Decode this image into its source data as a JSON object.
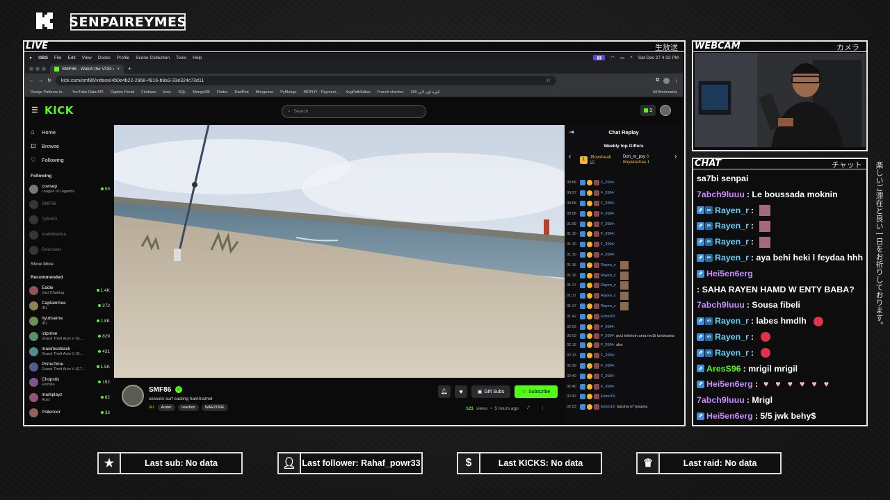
{
  "header": {
    "channel_name": "SENPAIREYMES"
  },
  "panels": {
    "live_title": "LIVE",
    "live_jp": "生放送",
    "webcam_title": "WEBCAM",
    "webcam_jp": "カメラ",
    "chat_title": "CHAT",
    "chat_jp": "チャット",
    "vertical_jp": "楽しいご滞在と良い一日をお祈りしております。"
  },
  "os_menubar": {
    "items": [
      "OBS",
      "File",
      "Edit",
      "View",
      "Docks",
      "Profile",
      "Scene Collection",
      "Tools",
      "Help"
    ],
    "clock": "Sat Dec 27  4:32 PM"
  },
  "browser": {
    "tab_title": "SMF86 - Watch the VOD on K",
    "url": "kick.com/smf86/videos/4b0e4b22-2968-4916-b9a3-33e324c73d11",
    "bookmarks": [
      "Design Patterns In...",
      "YouTube Data API",
      "Captive Portal",
      "Firebase",
      "Ionic",
      "SQL",
      "MongoDB",
      "Flutter",
      "DartPad",
      "Mongoose",
      "PyMongo",
      "MOPHY - Paymeni...",
      "SvgPathEditor",
      "French checker",
      "كورة اون لاين 360"
    ],
    "all_bookmarks": "All Bookmarks"
  },
  "kick": {
    "logo": "KICK",
    "search_placeholder": "Search",
    "badge_count": "3",
    "nav": [
      {
        "label": "Home",
        "icon": "home-icon"
      },
      {
        "label": "Browse",
        "icon": "browse-icon"
      },
      {
        "label": "Following",
        "icon": "heart-icon"
      }
    ],
    "following_label": "Following",
    "following": [
      {
        "name": "cowsep",
        "sub": "League of Legends",
        "count": "59",
        "live": true
      },
      {
        "name": "SMF86",
        "sub": "",
        "count": "",
        "live": false
      },
      {
        "name": "TyBo00",
        "sub": "",
        "count": "",
        "live": false
      },
      {
        "name": "malekkairoa",
        "sub": "",
        "count": "",
        "live": false
      },
      {
        "name": "Dracowar",
        "sub": "",
        "count": "",
        "live": false
      }
    ],
    "show_more": "Show More",
    "recommended_label": "Recommended",
    "recommended": [
      {
        "name": "Eddie",
        "sub": "Just Chatting",
        "count": "1.4K"
      },
      {
        "name": "CaptainGee",
        "sub": "IRL",
        "count": "372"
      },
      {
        "name": "hyubsama",
        "sub": "IRL",
        "count": "1.8K"
      },
      {
        "name": "iziprime",
        "sub": "Grand Theft Auto V (G...",
        "count": "829"
      },
      {
        "name": "maximusblack",
        "sub": "Grand Theft Auto V (G...",
        "count": "431"
      },
      {
        "name": "PrimeTime",
        "sub": "Grand Theft Auto V (GT...",
        "count": "1.5K"
      },
      {
        "name": "Chopstix",
        "sub": "Fortnite",
        "count": "192"
      },
      {
        "name": "markplayz",
        "sub": "Rust",
        "count": "82"
      },
      {
        "name": "Psilencer",
        "sub": "",
        "count": "33"
      }
    ],
    "stream": {
      "channel": "SMF86",
      "title": "session surf casting hammamet",
      "category": "IRL",
      "tags": [
        "Arabic",
        "reaction",
        "WARZONE"
      ],
      "views": "121",
      "views_label": "views",
      "age": "5 hours ago",
      "gift_label": "Gift Subs",
      "subscribe_label": "Subscribe"
    },
    "replay": {
      "title": "Chat Replay",
      "top_gifters_label": "Weekly top Gifters",
      "gifters": [
        {
          "rank": "1",
          "name": "Jflow4reall",
          "count": "15"
        },
        {
          "name": "Don_m_psy",
          "count": "6"
        },
        {
          "name": "Boyakashaa",
          "count": "1"
        }
      ],
      "rows": [
        {
          "time": "00:56",
          "user": "F_2004:",
          "text": ""
        },
        {
          "time": "00:57",
          "user": "F_2004:",
          "text": ""
        },
        {
          "time": "00:58",
          "user": "F_2004:",
          "text": ""
        },
        {
          "time": "00:58",
          "user": "F_2004:",
          "text": ""
        },
        {
          "time": "01:09",
          "user": "F_2004:",
          "text": ""
        },
        {
          "time": "01:10",
          "user": "F_2004:",
          "text": ""
        },
        {
          "time": "01:10",
          "user": "F_2004:",
          "text": ""
        },
        {
          "time": "01:10",
          "user": "F_2004:",
          "text": ""
        },
        {
          "time": "01:16",
          "user": "Rayen_r:",
          "text": ""
        },
        {
          "time": "01:16",
          "user": "Rayen_r:",
          "text": ""
        },
        {
          "time": "01:17",
          "user": "Rayen_r:",
          "text": ""
        },
        {
          "time": "01:17",
          "user": "Rayen_r:",
          "text": ""
        },
        {
          "time": "01:17",
          "user": "Rayen_r:",
          "text": ""
        },
        {
          "time": "01:42",
          "user": "Ezioo19:",
          "text": ""
        },
        {
          "time": "02:03",
          "user": "F_2004:",
          "text": ""
        },
        {
          "time": "02:03",
          "user": "F_2004:",
          "text": "puci telekom ama moSi tunisisana"
        },
        {
          "time": "02:12",
          "user": "F_2004:",
          "text": "aha"
        },
        {
          "time": "02:13",
          "user": "F_2004:",
          "text": ""
        },
        {
          "time": "02:39",
          "user": "F_2004:",
          "text": ""
        },
        {
          "time": "02:40",
          "user": "F_2004:",
          "text": ""
        },
        {
          "time": "02:40",
          "user": "F_2004:",
          "text": ""
        },
        {
          "time": "02:42",
          "user": "Ezioo19:",
          "text": ""
        },
        {
          "time": "02:53",
          "user": "Ezioo19:",
          "text": "barcha n7 lyouma"
        }
      ]
    }
  },
  "chat": [
    {
      "user": "sa7bi senpai",
      "color": "#ffffff",
      "text": "",
      "badges": 0
    },
    {
      "user": "7abch9luuu",
      "color": "#c58cff",
      "text": ": Le boussada moknin",
      "badges": 0
    },
    {
      "user": "Rayen_r",
      "color": "#5fd3ff",
      "text": ":",
      "badges": 2
    },
    {
      "user": "Rayen_r",
      "color": "#5fd3ff",
      "text": ":",
      "badges": 2
    },
    {
      "user": "Rayen_r",
      "color": "#5fd3ff",
      "text": ":",
      "badges": 2
    },
    {
      "user": "Rayen_r",
      "color": "#5fd3ff",
      "text": ": aya behi heki l feydaa hhh",
      "badges": 2
    },
    {
      "user": "Hei5en6erg",
      "color": "#c58cff",
      "text": ": SAHA RAYEN HAMD W ENTY BABA?",
      "badges": 1
    },
    {
      "user": "7abch9luuu",
      "color": "#c58cff",
      "text": ": Sousa fibeli",
      "badges": 0
    },
    {
      "user": "Rayen_r",
      "color": "#5fd3ff",
      "text": ": labes hmdlh",
      "badges": 2
    },
    {
      "user": "Rayen_r",
      "color": "#5fd3ff",
      "text": ":",
      "badges": 2
    },
    {
      "user": "Rayen_r",
      "color": "#5fd3ff",
      "text": ":",
      "badges": 2
    },
    {
      "user": "AresS96",
      "color": "#53fc18",
      "text": ": mrigil mrigil",
      "badges": 1
    },
    {
      "user": "Hei5en6erg",
      "color": "#c58cff",
      "text": ":",
      "badges": 1
    },
    {
      "user": "7abch9luuu",
      "color": "#c58cff",
      "text": ": Mrigl",
      "badges": 0
    },
    {
      "user": "Hei5en6erg",
      "color": "#c58cff",
      "text": ": 5/5 jwk behy$",
      "badges": 1
    }
  ],
  "alerts": [
    {
      "label": "Last sub: No data",
      "icon": "star-icon"
    },
    {
      "label": "Last follower: Rahaf_powr33",
      "icon": "add-user-icon"
    },
    {
      "label": "Last KICKS: No data",
      "icon": "dollar-icon"
    },
    {
      "label": "Last raid: No data",
      "icon": "crown-icon"
    }
  ],
  "colors": {
    "kick_green": "#53fc18",
    "frame": "#e8e8e8"
  }
}
